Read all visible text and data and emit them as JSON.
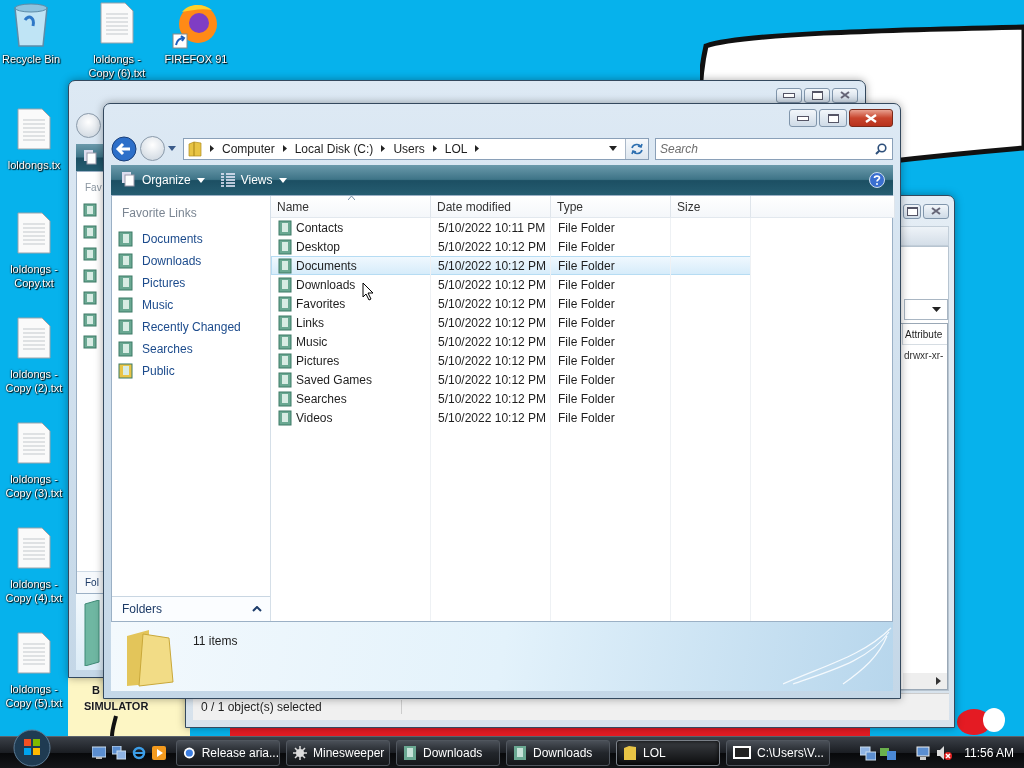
{
  "desktop_icons": [
    {
      "label": "Recycle Bin",
      "kind": "recycle"
    },
    {
      "label": "loldongs - Copy (6).txt",
      "kind": "text"
    },
    {
      "label": "FIREFOX 91",
      "kind": "browser"
    },
    {
      "label": "loldongs.tx",
      "kind": "text"
    },
    {
      "label": "loldongs - Copy.txt",
      "kind": "text"
    },
    {
      "label": "loldongs - Copy (2).txt",
      "kind": "text"
    },
    {
      "label": "loldongs - Copy (3).txt",
      "kind": "text"
    },
    {
      "label": "loldongs - Copy (4).txt",
      "kind": "text"
    },
    {
      "label": "loldongs - Copy (5).txt",
      "kind": "text"
    },
    {
      "label": "B",
      "kind": "covered"
    },
    {
      "label": "SIMULATOR",
      "kind": "covered"
    }
  ],
  "back_window": {
    "favorites_header": "Fav",
    "folders_label": "Fol"
  },
  "ftp_window": {
    "column_header": "Attribute",
    "cell": "drwxr-xr-",
    "status": "0 / 1 object(s) selected"
  },
  "explorer": {
    "address": [
      "Computer",
      "Local Disk (C:)",
      "Users",
      "LOL"
    ],
    "search": {
      "placeholder": "Search"
    },
    "toolbar": [
      "Organize",
      "Views"
    ],
    "favorite_links": {
      "title": "Favorite Links",
      "items": [
        "Documents",
        "Downloads",
        "Pictures",
        "Music",
        "Recently Changed",
        "Searches",
        "Public"
      ]
    },
    "folders_label": "Folders",
    "columns": [
      "Name",
      "Date modified",
      "Type",
      "Size"
    ],
    "rows": [
      {
        "name": "Contacts",
        "date": "5/10/2022 10:11 PM",
        "type": "File Folder",
        "selected": false
      },
      {
        "name": "Desktop",
        "date": "5/10/2022 10:12 PM",
        "type": "File Folder",
        "selected": false
      },
      {
        "name": "Documents",
        "date": "5/10/2022 10:12 PM",
        "type": "File Folder",
        "selected": true
      },
      {
        "name": "Downloads",
        "date": "5/10/2022 10:12 PM",
        "type": "File Folder",
        "selected": false
      },
      {
        "name": "Favorites",
        "date": "5/10/2022 10:12 PM",
        "type": "File Folder",
        "selected": false
      },
      {
        "name": "Links",
        "date": "5/10/2022 10:12 PM",
        "type": "File Folder",
        "selected": false
      },
      {
        "name": "Music",
        "date": "5/10/2022 10:12 PM",
        "type": "File Folder",
        "selected": false
      },
      {
        "name": "Pictures",
        "date": "5/10/2022 10:12 PM",
        "type": "File Folder",
        "selected": false
      },
      {
        "name": "Saved Games",
        "date": "5/10/2022 10:12 PM",
        "type": "File Folder",
        "selected": false
      },
      {
        "name": "Searches",
        "date": "5/10/2022 10:12 PM",
        "type": "File Folder",
        "selected": false
      },
      {
        "name": "Videos",
        "date": "5/10/2022 10:12 PM",
        "type": "File Folder",
        "selected": false
      }
    ],
    "details": "11 items"
  },
  "taskbar": {
    "buttons": [
      {
        "label": "Release aria...",
        "kind": "browser",
        "selected": false
      },
      {
        "label": "Minesweeper",
        "kind": "game",
        "selected": false
      },
      {
        "label": "Downloads",
        "kind": "folder",
        "selected": false
      },
      {
        "label": "Downloads",
        "kind": "folder",
        "selected": false
      },
      {
        "label": "LOL",
        "kind": "explorer",
        "selected": true
      },
      {
        "label": "C:\\Users\\V...",
        "kind": "archive",
        "selected": false
      }
    ],
    "clock": "11:56 AM"
  }
}
